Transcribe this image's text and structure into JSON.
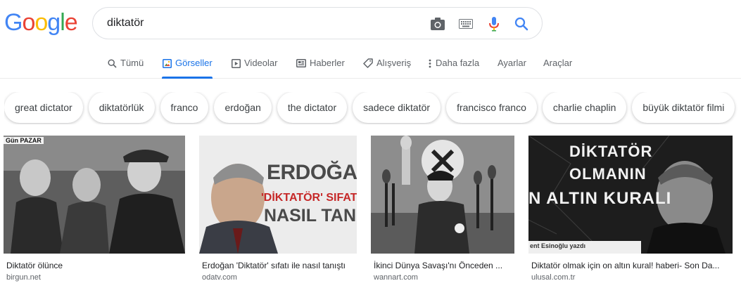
{
  "logo": {
    "letters": [
      "G",
      "o",
      "o",
      "g",
      "l",
      "e"
    ],
    "colors": [
      "#4285F4",
      "#EA4335",
      "#FBBC05",
      "#4285F4",
      "#34A853",
      "#EA4335"
    ]
  },
  "search": {
    "value": "diktatör",
    "icons": [
      "camera-icon",
      "keyboard-icon",
      "microphone-icon",
      "search-icon"
    ]
  },
  "tabs": [
    {
      "label": "Tümü",
      "icon": "search-icon"
    },
    {
      "label": "Görseller",
      "icon": "image-icon",
      "active": true
    },
    {
      "label": "Videolar",
      "icon": "play-icon"
    },
    {
      "label": "Haberler",
      "icon": "news-icon"
    },
    {
      "label": "Alışveriş",
      "icon": "tag-icon"
    },
    {
      "label": "Daha fazla",
      "icon": "more-vert-icon"
    },
    {
      "label": "Ayarlar"
    },
    {
      "label": "Araçlar"
    }
  ],
  "chips": [
    "great dictator",
    "diktatörlük",
    "franco",
    "erdoğan",
    "the dictator",
    "sadece diktatör",
    "francisco franco",
    "charlie chaplin",
    "büyük diktatör filmi"
  ],
  "results": [
    {
      "title": "Diktatör ölünce",
      "source": "birgun.net",
      "overlay": "Gün PAZAR"
    },
    {
      "title": "Erdoğan 'Diktatör' sıfatı ile nasıl tanıştı",
      "source": "odatv.com",
      "overlay_lines": [
        "ERDOĞAN",
        "'DİKTATÖR' SIFATI İL",
        "NASIL TANIŞT"
      ]
    },
    {
      "title": "İkinci Dünya Savaşı'nı Önceden ...",
      "source": "wannart.com"
    },
    {
      "title": "Diktatör olmak için on altın kural! haberi- Son Da...",
      "source": "ulusal.com.tr",
      "overlay_lines": [
        "DİKTATÖR",
        "OLMANIN",
        "N ALTIN KURALI"
      ],
      "caption": "ent Esinoğlu yazdı"
    }
  ],
  "colors": {
    "accent": "#1a73e8",
    "mic_blue": "#4285F4",
    "mic_red": "#EA4335",
    "text": "#202124",
    "secondary": "#5f6368"
  }
}
